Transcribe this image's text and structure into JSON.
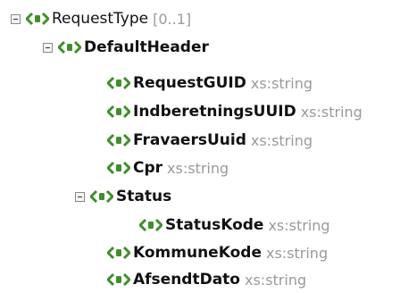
{
  "tree": {
    "root": {
      "name": "RequestType",
      "card": "[0..1]"
    },
    "default_header": {
      "name": "DefaultHeader"
    },
    "request_guid": {
      "name": "RequestGUID",
      "type": "xs:string"
    },
    "indberetnings_uuid": {
      "name": "IndberetningsUUID",
      "type": "xs:string"
    },
    "fravaers_uuid": {
      "name": "FravaersUuid",
      "type": "xs:string"
    },
    "cpr": {
      "name": "Cpr",
      "type": "xs:string"
    },
    "status": {
      "name": "Status"
    },
    "status_kode": {
      "name": "StatusKode",
      "type": "xs:string"
    },
    "kommune_kode": {
      "name": "KommuneKode",
      "type": "xs:string"
    },
    "afsendt_dato": {
      "name": "AfsendtDato",
      "type": "xs:string"
    }
  },
  "icons": {
    "element": "xml-element-icon",
    "collapse": "collapse-icon"
  },
  "colors": {
    "icon_green": "#3f8f2b",
    "type_gray": "#9a9a9a"
  }
}
